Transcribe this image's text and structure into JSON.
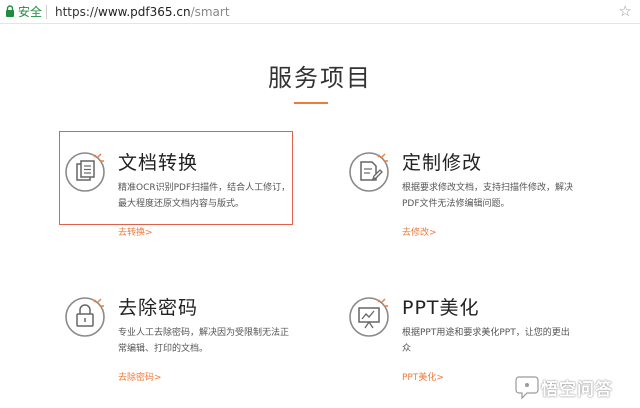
{
  "browser": {
    "secure_label": "安全",
    "url_scheme": "https://",
    "url_host": "www.pdf365.cn",
    "url_path": "/smart"
  },
  "page": {
    "title": "服务项目"
  },
  "services": [
    {
      "title": "文档转换",
      "desc": "精准OCR识别PDF扫描件，结合人工修订，最大程度还原文档内容与版式。",
      "link": "去转换>"
    },
    {
      "title": "定制修改",
      "desc": "根据要求修改文档，支持扫描件修改，解决PDF文件无法修编辑问题。",
      "link": "去修改>"
    },
    {
      "title": "去除密码",
      "desc": "专业人工去除密码，解决因为受限制无法正常编辑、打印的文档。",
      "link": "去除密码>"
    },
    {
      "title": "PPT美化",
      "desc": "根据PPT用途和要求美化PPT，让您的更出众",
      "link": "PPT美化>"
    }
  ],
  "watermark": {
    "text": "悟空问答"
  },
  "colors": {
    "accent": "#f07a3a",
    "highlight_border": "#e0604a",
    "secure_green": "#1e8e3e"
  }
}
